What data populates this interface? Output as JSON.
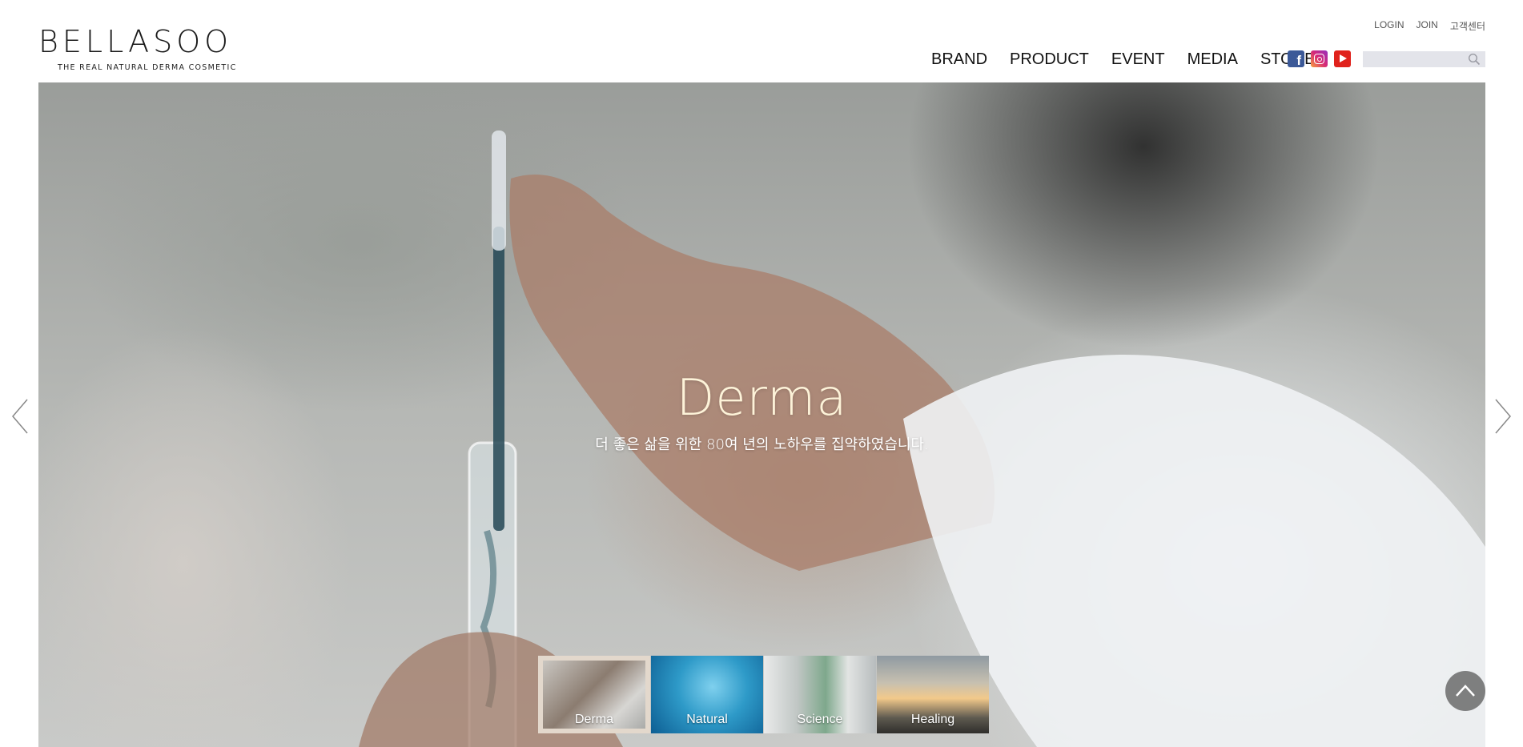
{
  "brand": {
    "name": "BELLASOO",
    "tagline": "THE REAL NATURAL DERMA COSMETIC"
  },
  "util_nav": [
    "LOGIN",
    "JOIN",
    "고객센터"
  ],
  "main_nav": [
    "BRAND",
    "PRODUCT",
    "EVENT",
    "MEDIA",
    "STORE"
  ],
  "social_icons": [
    "facebook-icon",
    "instagram-icon",
    "youtube-icon"
  ],
  "search": {
    "value": "",
    "placeholder": ""
  },
  "hero": {
    "title": "Derma",
    "subtitle": "더 좋은 삶을 위한 80여 년의 노하우를 집약하였습니다.",
    "slides": [
      "Derma",
      "Natural",
      "Science",
      "Healing"
    ],
    "active_slide": 0
  },
  "colors": {
    "hero_title": "#fdf3d9",
    "active_thumb_border": "#e3d8cc",
    "search_bg": "#e3e4ea",
    "facebook": "#3b5998",
    "youtube": "#e0221c"
  }
}
